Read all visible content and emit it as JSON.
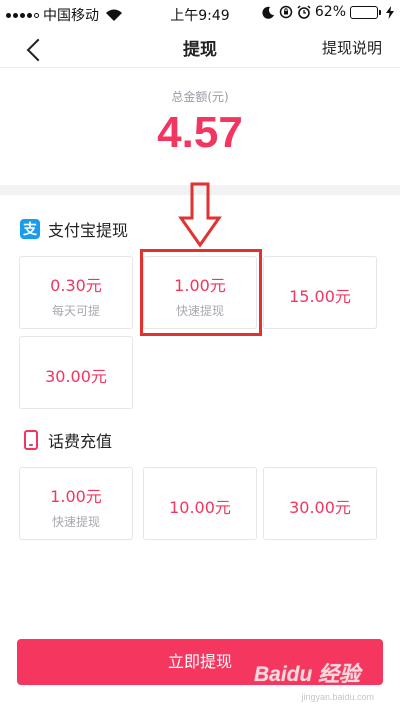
{
  "status_bar": {
    "carrier": "中国移动",
    "time": "上午9:49",
    "battery_percent_text": "62%",
    "battery_level": 0.62,
    "icons": [
      "signal-icon",
      "wifi-icon",
      "moon-icon",
      "orientation-lock-icon",
      "alarm-icon",
      "battery-icon",
      "charging-icon"
    ]
  },
  "nav": {
    "title": "提现",
    "right_link": "提现说明",
    "back_icon": "chevron-left-icon"
  },
  "balance": {
    "label": "总金额(元)",
    "amount": "4.57"
  },
  "alipay": {
    "title": "支付宝提现",
    "icon_glyph": "支",
    "options": [
      {
        "amount": "0.30元",
        "note": "每天可提"
      },
      {
        "amount": "1.00元",
        "note": "快速提现"
      },
      {
        "amount": "15.00元",
        "note": ""
      },
      {
        "amount": "30.00元",
        "note": ""
      }
    ]
  },
  "phone_credit": {
    "title": "话费充值",
    "options": [
      {
        "amount": "1.00元",
        "note": "快速提现"
      },
      {
        "amount": "10.00元",
        "note": ""
      },
      {
        "amount": "30.00元",
        "note": ""
      }
    ]
  },
  "submit_label": "立即提现",
  "watermark": {
    "brand": "Baidu 经验",
    "url": "jingyan.baidu.com"
  },
  "colors": {
    "accent": "#f2365f",
    "button": "#f5365e",
    "alipay_blue": "#1a9cec",
    "annotation_red": "#e23131"
  }
}
